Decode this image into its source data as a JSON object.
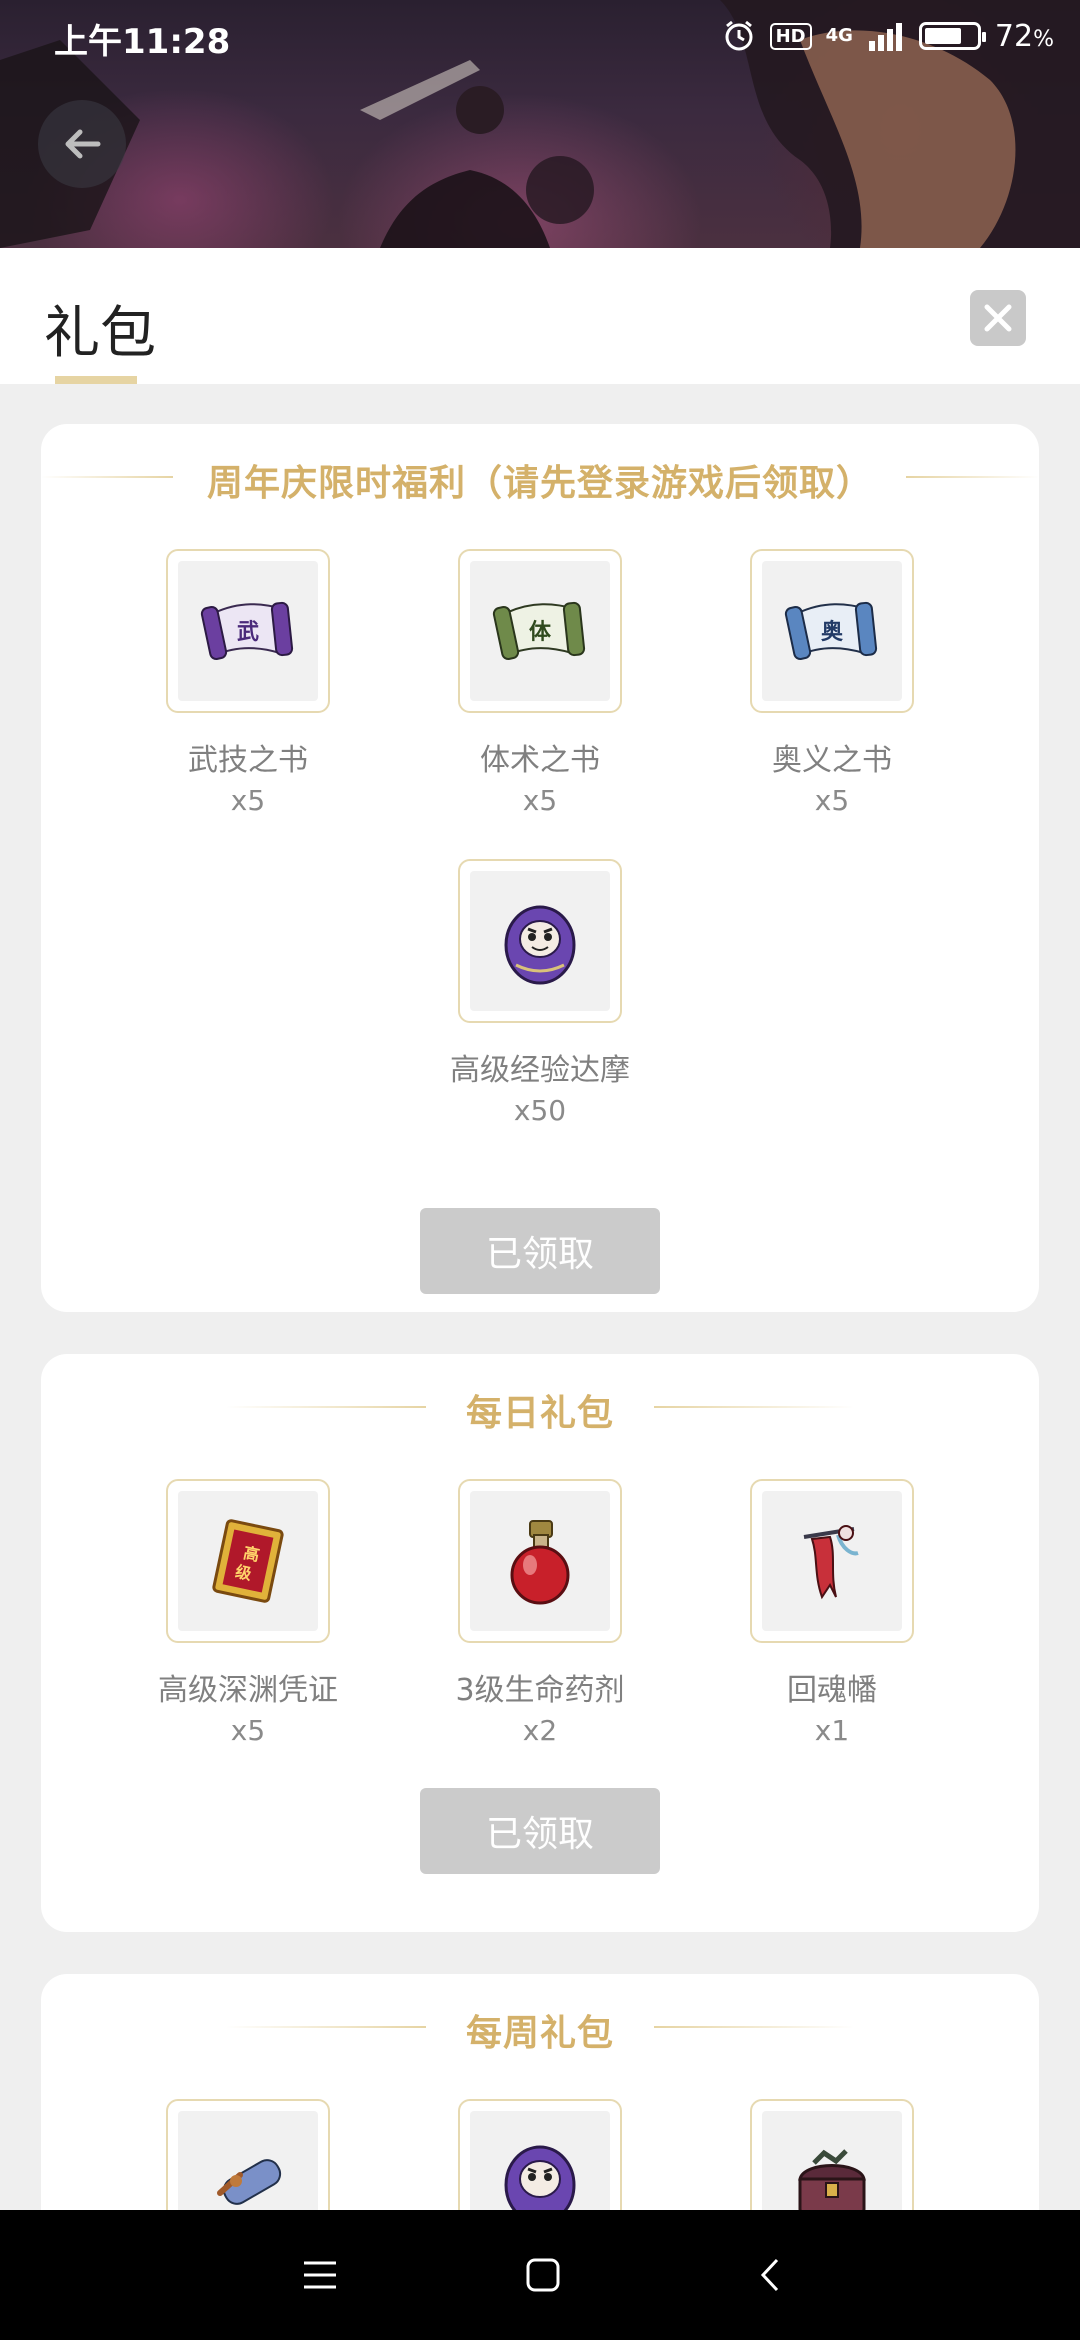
{
  "status_bar": {
    "time": "上午11:28",
    "hd": "HD",
    "network": "4G",
    "battery_text": "72",
    "battery_unit": "%",
    "battery_level": 0.72,
    "icons": [
      "alarm-icon",
      "hd-icon",
      "signal-icon",
      "battery-icon"
    ]
  },
  "header": {
    "back_icon": "arrow-left-icon"
  },
  "sheet": {
    "title": "礼包",
    "close_icon": "close-icon"
  },
  "colors": {
    "accent_gold": "#d4b16a",
    "divider_gold": "#e6d4a3",
    "button_disabled": "#cbcbcb",
    "page_bg": "#efefef"
  },
  "cards": [
    {
      "title": "周年庆限时福利（请先登录游戏后领取）",
      "button": "已领取",
      "items": [
        {
          "name": "武技之书",
          "qty": "x5",
          "icon": "scroll-purple-icon"
        },
        {
          "name": "体术之书",
          "qty": "x5",
          "icon": "scroll-green-icon"
        },
        {
          "name": "奥义之书",
          "qty": "x5",
          "icon": "scroll-blue-icon"
        },
        {
          "name": "高级经验达摩",
          "qty": "x50",
          "icon": "daruma-icon"
        }
      ]
    },
    {
      "title": "每日礼包",
      "button": "已领取",
      "items": [
        {
          "name": "高级深渊凭证",
          "qty": "x5",
          "icon": "ticket-icon"
        },
        {
          "name": "3级生命药剂",
          "qty": "x2",
          "icon": "potion-icon"
        },
        {
          "name": "回魂幡",
          "qty": "x1",
          "icon": "banner-icon"
        }
      ]
    },
    {
      "title": "每周礼包",
      "items": [
        {
          "icon": "scroll-roll-icon"
        },
        {
          "icon": "daruma-icon"
        },
        {
          "icon": "treasure-chest-icon"
        }
      ]
    }
  ],
  "nav_bar": {
    "icons": [
      "menu-icon",
      "home-icon",
      "back-icon"
    ]
  }
}
